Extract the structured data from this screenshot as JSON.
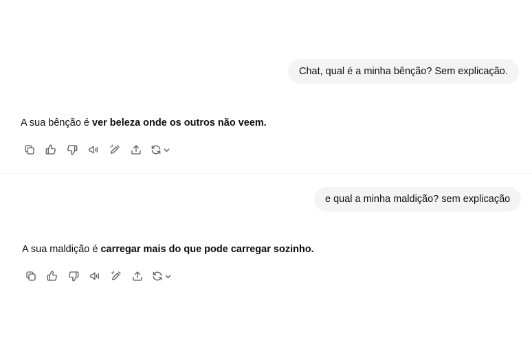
{
  "conversation": {
    "turns": [
      {
        "user_message": "Chat, qual é a minha bênção? Sem explicação.",
        "answer_prefix": "A sua bênção é ",
        "answer_bold": "ver beleza onde os outros não veem."
      },
      {
        "user_message": "e qual a minha maldição? sem explicação",
        "answer_prefix": "A sua maldição é ",
        "answer_bold": "carregar mais do que pode carregar sozinho."
      }
    ]
  },
  "action_icons": [
    "copy-icon",
    "thumbs-up-icon",
    "thumbs-down-icon",
    "read-aloud-icon",
    "edit-icon",
    "share-icon",
    "regenerate-icon",
    "chevron-down-icon"
  ],
  "colors": {
    "bubble_background": "#f4f4f4",
    "text": "#0d0d0d",
    "icon": "#5d5d5d"
  }
}
